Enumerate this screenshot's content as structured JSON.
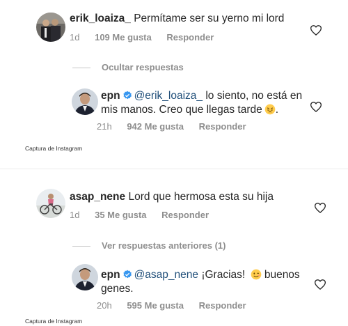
{
  "comment1": {
    "username": "erik_loaiza_",
    "text": "Permítame ser su yerno mi lord",
    "time": "1d",
    "likes": "109 Me gusta",
    "reply": "Responder"
  },
  "toggle1": "Ocultar respuestas",
  "reply1": {
    "username": "epn",
    "mention": "@erik_loaiza_",
    "text_line1": "lo siento, no está en",
    "text_line2": "mis manos. Creo que llegas tarde",
    "text_end": ".",
    "time": "21h",
    "likes": "942 Me gusta",
    "reply": "Responder"
  },
  "caption1": "Captura de Instagram",
  "comment2": {
    "username": "asap_nene",
    "text": "Lord que hermosa esta su hija",
    "time": "1d",
    "likes": "35 Me gusta",
    "reply": "Responder"
  },
  "toggle2": "Ver respuestas anteriores (1)",
  "reply2": {
    "username": "epn",
    "mention": "@asap_nene",
    "text_line1": "¡Gracias!",
    "text_line1_end": "buenos",
    "text_line2": "genes.",
    "time": "20h",
    "likes": "595 Me gusta",
    "reply": "Responder"
  },
  "caption2": "Captura de Instagram",
  "colors": {
    "username": "#262626",
    "mention": "#1f4e79",
    "meta": "#8e8e8e",
    "verified": "#3897f0"
  },
  "icons": [
    "heart-icon",
    "verified-badge-icon",
    "pensive-face-emoji",
    "wink-face-emoji"
  ]
}
